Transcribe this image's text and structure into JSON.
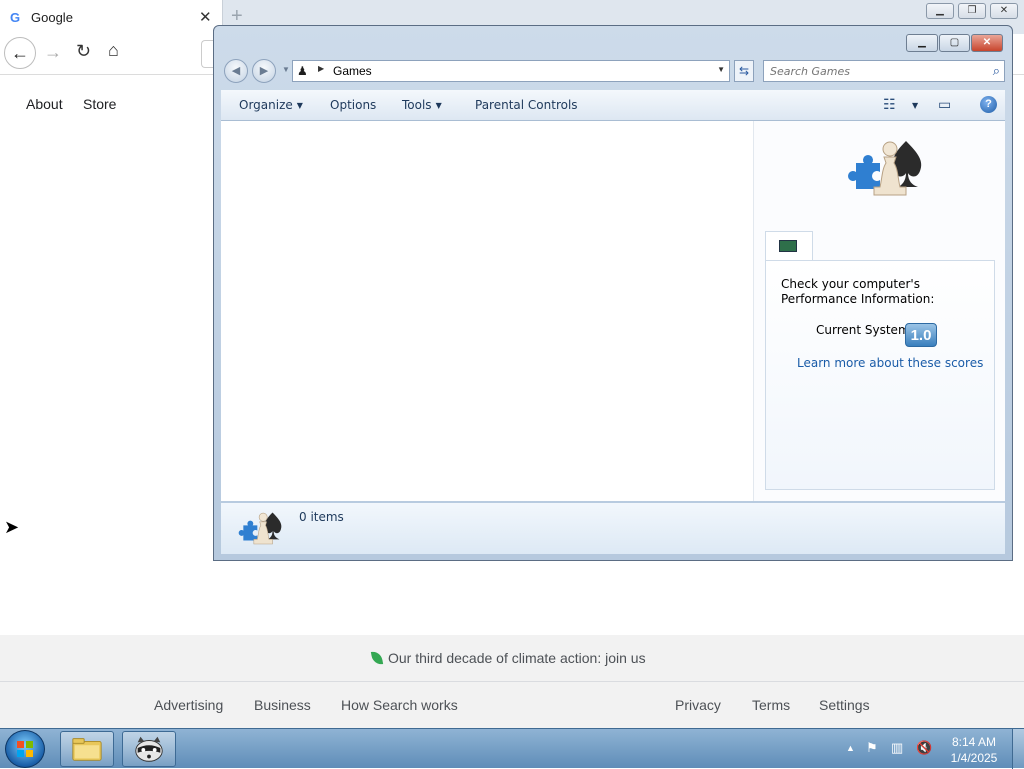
{
  "browser": {
    "tab_title": "Google",
    "tab_favicon": "G",
    "nav": {
      "back_icon": "←",
      "forward_icon": "→",
      "reload_icon": "↻",
      "home_icon": "⌂"
    },
    "top_links": [
      "About",
      "Store"
    ],
    "footer": {
      "climate_text": "Our third decade of climate action: join us",
      "left_links": [
        "Advertising",
        "Business",
        "How Search works"
      ],
      "right_links": [
        "Privacy",
        "Terms",
        "Settings"
      ]
    }
  },
  "games_window": {
    "address": "Games",
    "search_placeholder": "Search Games",
    "commands": {
      "organize": "Organize",
      "options": "Options",
      "tools": "Tools",
      "parental": "Parental Controls"
    },
    "help_label": "?",
    "performance": {
      "message": "Check your computer's Performance Information:",
      "current_label": "Current System",
      "score": "1.0",
      "learn_link": "Learn more about these scores"
    },
    "status": "0 items"
  },
  "taskbar": {
    "time": "8:14 AM",
    "date": "1/4/2025",
    "tray_icons": [
      "show-hidden-icon",
      "action-center-flag-icon",
      "network-icon",
      "volume-muted-icon"
    ]
  },
  "colors": {
    "window_frame": "#b6c9de",
    "link_blue": "#1a5ca8",
    "taskbar": "#5f8db8",
    "footer_bg": "#f2f2f2",
    "leaf_green": "#34a853"
  }
}
